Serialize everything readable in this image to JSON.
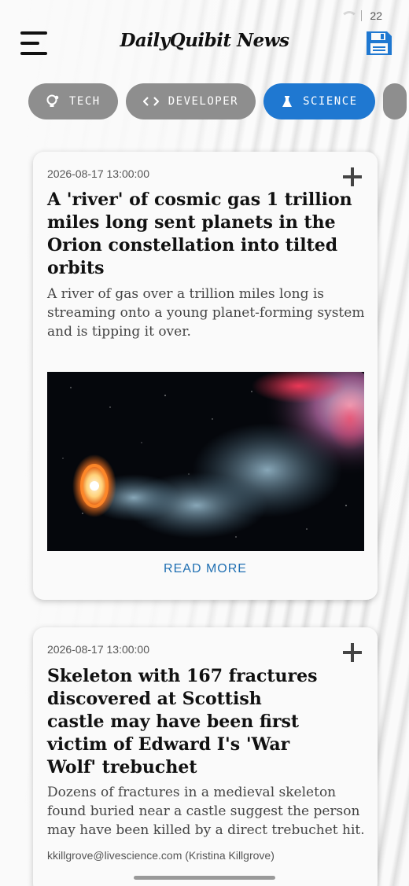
{
  "status_bar": {
    "time": "22"
  },
  "header": {
    "brand": "DailyQuibit News",
    "menu_icon": "hamburger-menu-icon",
    "save_icon": "floppy-save-icon"
  },
  "categories": [
    {
      "label": "TECH",
      "icon": "lightbulb-gear-icon",
      "active": false
    },
    {
      "label": "DEVELOPER",
      "icon": "code-brackets-icon",
      "active": false
    },
    {
      "label": "SCIENCE",
      "icon": "flask-icon",
      "active": true
    }
  ],
  "colors": {
    "accent": "#1f78d1",
    "chip_inactive": "#8e8e8e",
    "link": "#1f6fb2"
  },
  "articles": [
    {
      "date": "2026-08-17 13:00:00",
      "title": "A 'river' of cosmic gas 1 trillion miles long sent planets in the Orion constellation into tilted orbits",
      "summary": "A river of gas over a trillion miles long is streaming onto a young planet-forming system and is tipping it over.",
      "read_more": "READ MORE",
      "add_icon": "plus-icon"
    },
    {
      "date": "2026-08-17 13:00:00",
      "title": "Skeleton with 167 fractures discovered at Scottish castle may have been first victim of Edward I's 'War Wolf' trebuchet",
      "summary": "Dozens of fractures in a medieval skeleton found buried near a castle suggest the person may have been killed by a direct trebuchet hit.",
      "author": "kkillgrove@livescience.com (Kristina Killgrove)",
      "add_icon": "plus-icon"
    }
  ]
}
